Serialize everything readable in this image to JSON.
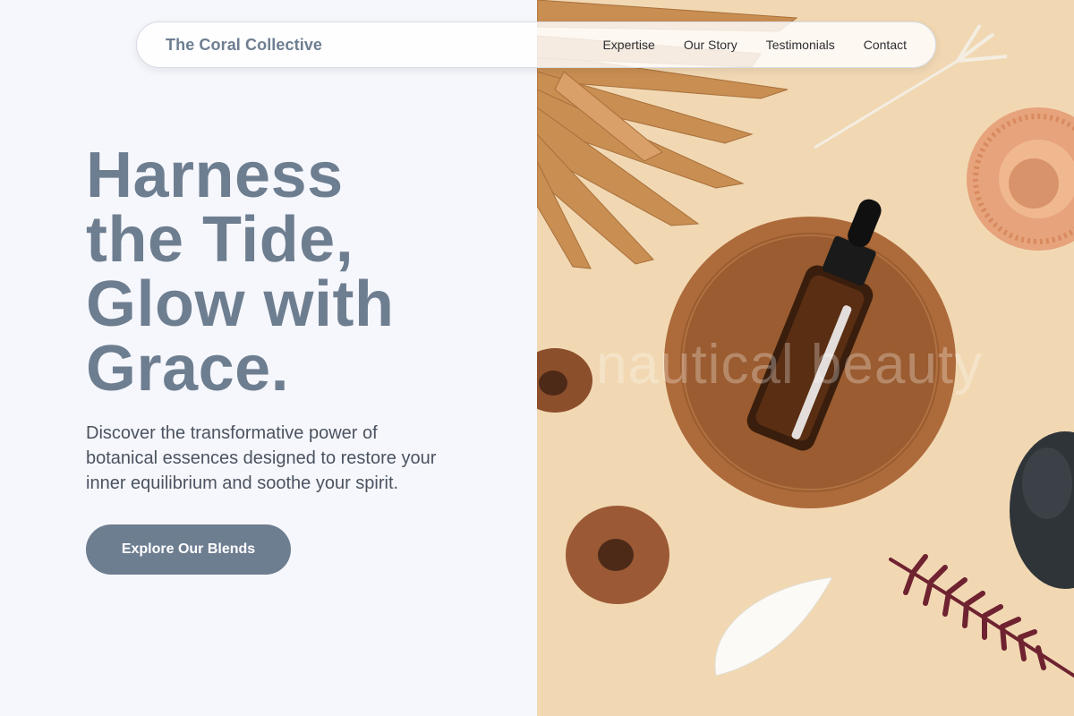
{
  "header": {
    "brand": "The Coral Collective",
    "nav": [
      {
        "label": "Expertise"
      },
      {
        "label": "Our Story"
      },
      {
        "label": "Testimonials"
      },
      {
        "label": "Contact"
      }
    ]
  },
  "hero": {
    "title_lines": [
      "Harness",
      "the Tide,",
      "Glow with",
      "Grace."
    ],
    "subtitle": "Discover the transformative power of botanical essences designed to restore your inner equilibrium and soothe your spirit.",
    "cta_label": "Explore Our Blends",
    "image_watermark": "nautical beauty"
  },
  "colors": {
    "accent": "#6e7e91",
    "page_background": "#f6f7fc",
    "image_background": "#f1d8b3"
  }
}
